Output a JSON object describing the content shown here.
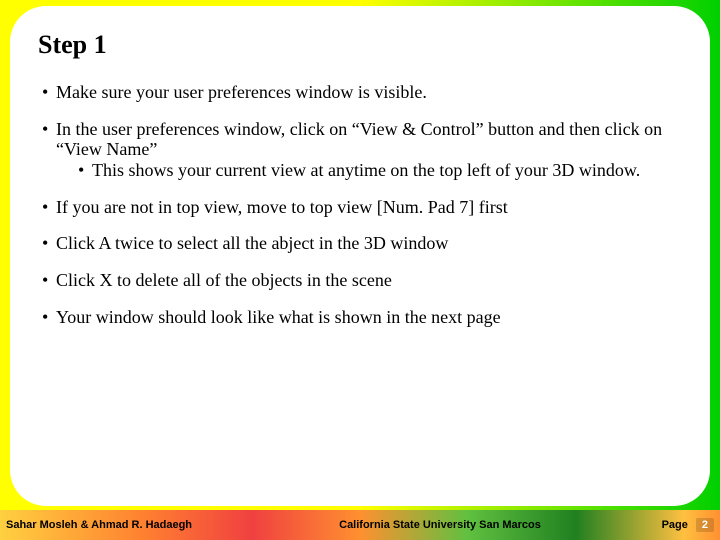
{
  "title": "Step 1",
  "bullets": {
    "b1": "Make sure your user preferences window is visible.",
    "b2": "In the user preferences window, click on “View & Control” button and then click on “View Name”",
    "b2_sub1": "This shows your current view at anytime on the top left of your 3D window.",
    "b3": "If you are not in top view, move to top view [Num. Pad 7] first",
    "b4": "Click A twice to select all the abject in the 3D window",
    "b5": "Click X to delete all of the objects in the scene",
    "b6": "Your window should look like what is shown in the next page"
  },
  "footer": {
    "authors": "Sahar Mosleh & Ahmad R. Hadaegh",
    "institution": "California State University San Marcos",
    "page_label": "Page",
    "page_number": "2"
  }
}
